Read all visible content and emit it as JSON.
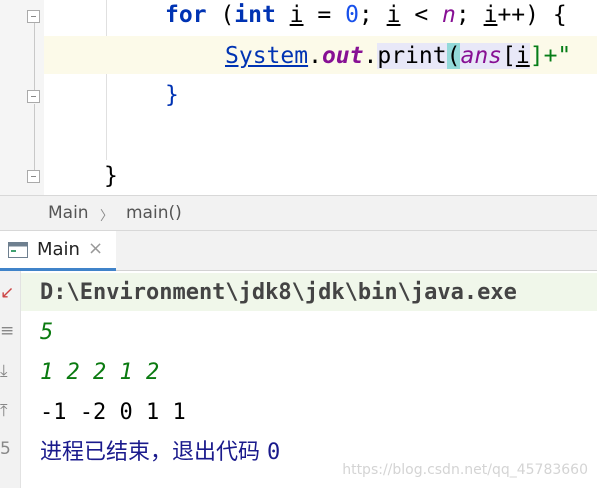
{
  "editor": {
    "lines": [
      {
        "for_kw": "for",
        "open": " (",
        "int_kw": "int",
        "sp": " ",
        "var_i": "i",
        "eq": " = ",
        "zero": "0",
        "semi1": "; ",
        "var_i2": "i",
        "lt": " < ",
        "n": "n",
        "semi2": "; ",
        "var_i3": "i",
        "inc": "++) {"
      },
      {
        "cls": "System",
        "dot1": ".",
        "field": "out",
        "dot2": ".",
        "method": "print",
        "lparen": "(",
        "ans": "ans",
        "lbr": "[",
        "idx": "i",
        "rbr": "]+\""
      },
      {
        "brace": "}"
      },
      {
        "brace": "}"
      }
    ]
  },
  "breadcrumb": {
    "class_name": "Main",
    "separator": "〉",
    "method_name": "main()"
  },
  "run_window": {
    "tab_label": "Main",
    "tab_close": "×",
    "console": {
      "command": "D:\\Environment\\jdk8\\jdk\\bin\\java.exe",
      "input_n": "5",
      "input_values": "1 2 2 1 2",
      "output": "-1 -2 0 1 1",
      "exit_text": "进程已结束，退出代码 ",
      "exit_code": "0"
    },
    "side_glyphs": [
      "↙",
      "≡",
      "⤓",
      "⤒",
      "5"
    ]
  },
  "watermark": "https://blog.csdn.net/qq_45783660",
  "colors": {
    "keyword": "#0033b3",
    "number": "#1750eb",
    "field": "#871094",
    "console_input": "#0a7a10",
    "exit": "#1a1a8c",
    "tab_underline": "#4083c9"
  }
}
